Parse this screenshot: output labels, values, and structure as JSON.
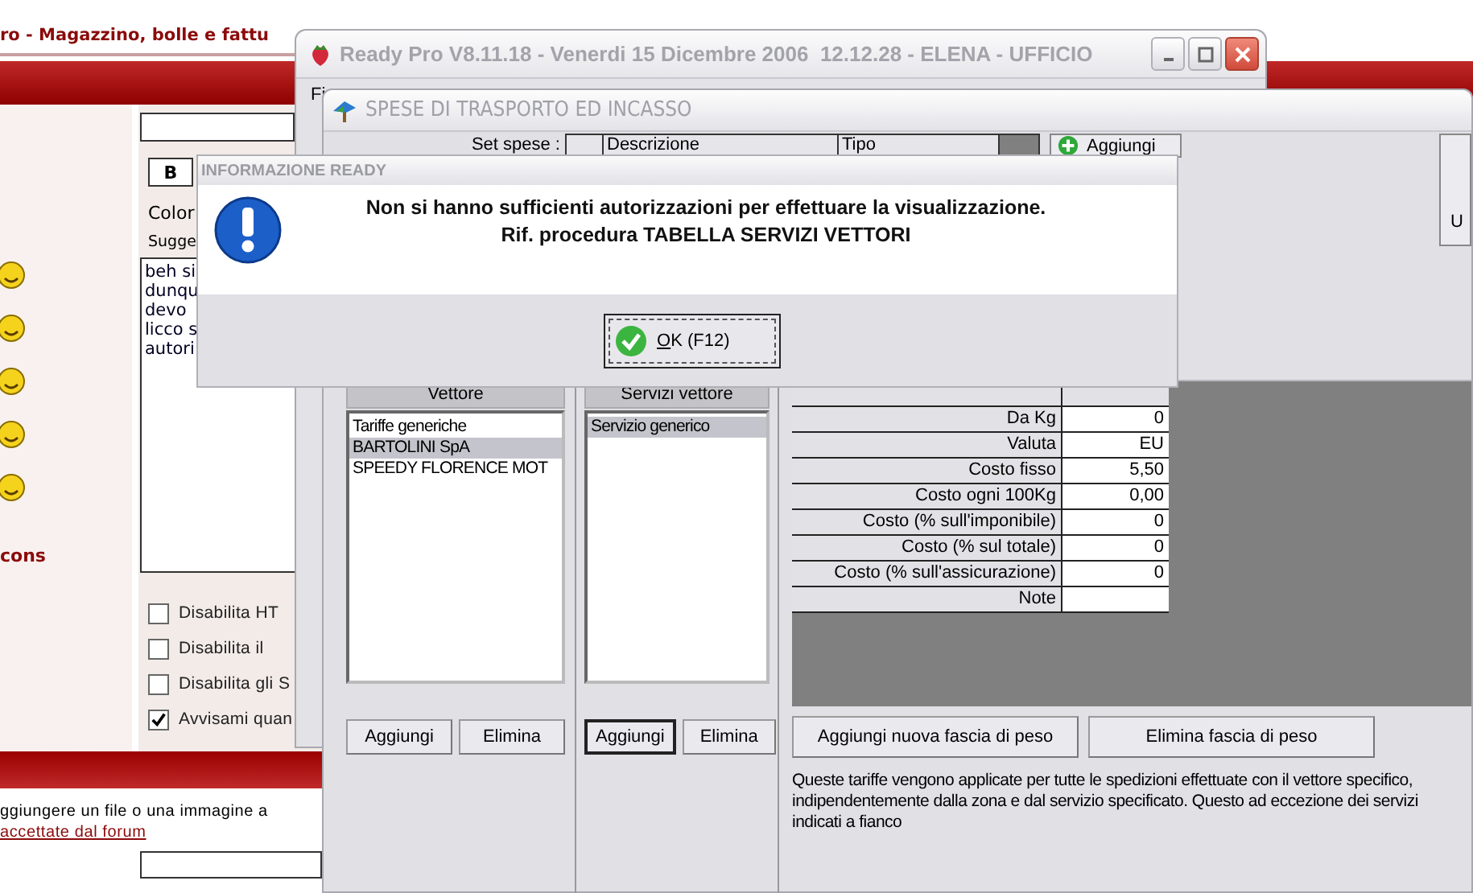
{
  "forum_page": {
    "title": "ro - Magazzino, bolle e fattu",
    "bold_button": "B",
    "color_label": "Color",
    "suggest_label": "Sugge",
    "message_lines": [
      "beh si",
      "dunqu",
      "devo",
      "licco s",
      "autori"
    ],
    "emoticons_caption": "cons",
    "options": [
      {
        "label": "Disabilita HT",
        "checked": false
      },
      {
        "label": "Disabilita il",
        "checked": false
      },
      {
        "label": "Disabilita gli S",
        "checked": false
      },
      {
        "label": "Avvisami quan",
        "checked": true
      }
    ],
    "attach_text": "ggiungere un file o una immagine a",
    "attach_link": "accettate dal forum"
  },
  "app_window": {
    "title": "Ready Pro V8.11.18 - Venerdi 15 Dicembre 2006  12.12.28 - ELENA - UFFICIO",
    "menu": [
      "Fi"
    ]
  },
  "transport_window": {
    "title": "SPESE DI TRASPORTO ED INCASSO",
    "set_label": "Set spese :",
    "set_columns": [
      "Descrizione",
      "Tipo"
    ],
    "add_button": "Aggiungi",
    "side_button": "U",
    "carriers": {
      "header": "Vettore",
      "items": [
        {
          "label": "Tariffe generiche",
          "selected": false
        },
        {
          "label": "BARTOLINI SpA",
          "selected": true
        },
        {
          "label": "SPEEDY FLORENCE MOT",
          "selected": false
        }
      ],
      "buttons": [
        {
          "label": "Aggiungi",
          "focused": false
        },
        {
          "label": "Elimina",
          "focused": false
        }
      ]
    },
    "services": {
      "header": "Servizi vettore",
      "items": [
        {
          "label": "Servizio generico",
          "selected": true
        }
      ],
      "buttons": [
        {
          "label": "Aggiungi",
          "focused": true
        },
        {
          "label": "Elimina",
          "focused": false
        }
      ]
    },
    "rates": [
      {
        "label": "Da Kg",
        "value": "0"
      },
      {
        "label": "Valuta",
        "value": "EU"
      },
      {
        "label": "Costo fisso",
        "value": "5,50"
      },
      {
        "label": "Costo ogni 100Kg",
        "value": "0,00"
      },
      {
        "label": "Costo (% sull'imponibile)",
        "value": "0"
      },
      {
        "label": "Costo (% sul totale)",
        "value": "0"
      },
      {
        "label": "Costo (% sull'assicurazione)",
        "value": "0"
      },
      {
        "label": "Note"
      }
    ],
    "band_buttons": [
      "Aggiungi nuova fascia di peso",
      "Elimina fascia di peso"
    ],
    "note": "Queste tariffe vengono applicate per tutte le spedizioni effettuate con il vettore specifico, indipendentemente dalla zona e dal servizio specificato. Questo ad eccezione dei servizi indicati a fianco"
  },
  "dialog": {
    "title": "INFORMAZIONE READY",
    "message_lines": [
      "Non si hanno sufficienti autorizzazioni per effettuare la visualizzazione.",
      "Rif. procedura TABELLA SERVIZI VETTORI"
    ],
    "ok_button": "OK (F12)"
  }
}
